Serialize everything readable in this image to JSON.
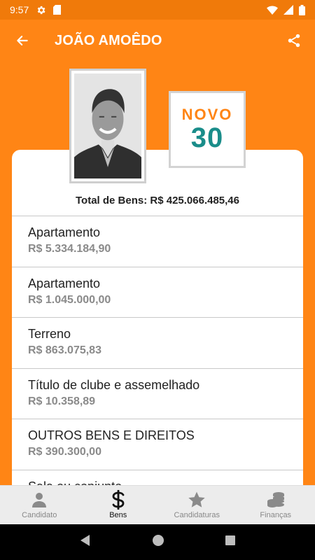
{
  "status_bar": {
    "time": "9:57"
  },
  "app_bar": {
    "title": "JOÃO AMOÊDO"
  },
  "party": {
    "name": "NOVO",
    "number": "30"
  },
  "total_label": "Total de Bens: R$ 425.066.485,46",
  "assets": [
    {
      "name": "Apartamento",
      "value": "R$ 5.334.184,90"
    },
    {
      "name": "Apartamento",
      "value": "R$ 1.045.000,00"
    },
    {
      "name": "Terreno",
      "value": "R$ 863.075,83"
    },
    {
      "name": "Título de clube e assemelhado",
      "value": "R$ 10.358,89"
    },
    {
      "name": "OUTROS BENS E DIREITOS",
      "value": "R$ 390.300,00"
    },
    {
      "name": "Sala ou conjunto",
      "value": ""
    }
  ],
  "bottom_nav": [
    {
      "label": "Candidato",
      "icon": "person-icon",
      "active": false
    },
    {
      "label": "Bens",
      "icon": "dollar-icon",
      "active": true
    },
    {
      "label": "Candidaturas",
      "icon": "star-icon",
      "active": false
    },
    {
      "label": "Finanças",
      "icon": "coins-icon",
      "active": false
    }
  ],
  "colors": {
    "primary": "#ff8515",
    "status_bar": "#f07a0a",
    "party_teal": "#1a8d8a"
  }
}
